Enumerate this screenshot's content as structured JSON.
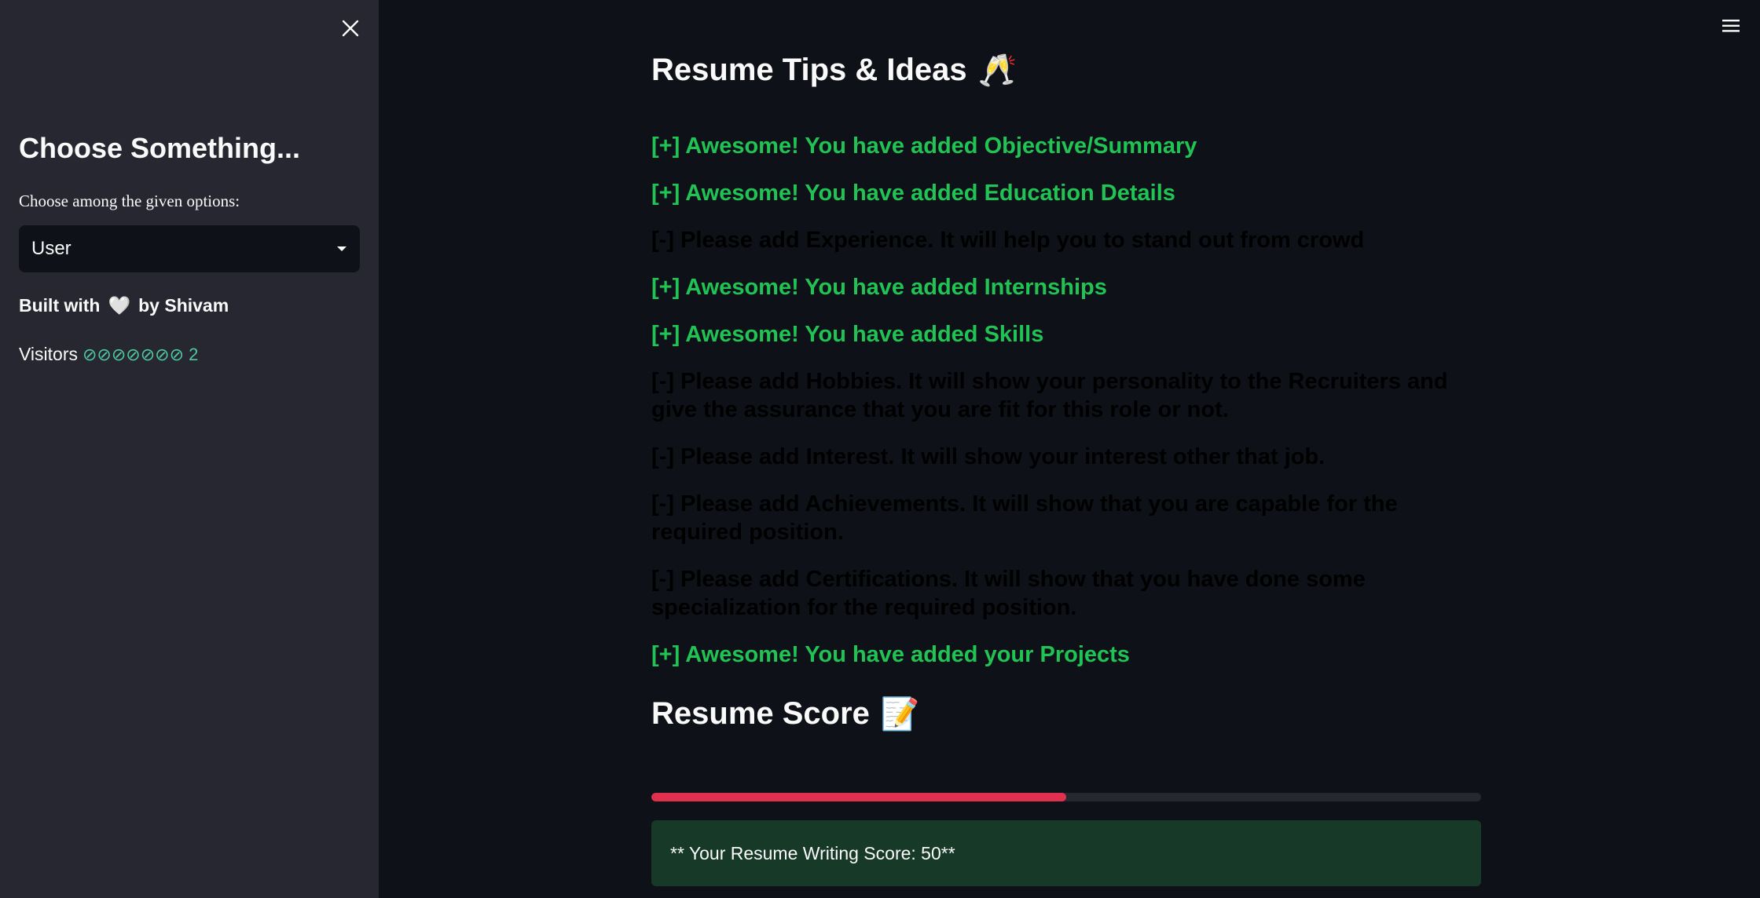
{
  "sidebar": {
    "title": "Choose Something...",
    "select_label": "Choose among the given options:",
    "select_value": "User",
    "built_with": "Built with",
    "built_by": "by Shivam",
    "heart_emoji": "🤍",
    "visitors_label": "Visitors",
    "visitors_count": "⊘⊘⊘⊘⊘⊘⊘ 2"
  },
  "main": {
    "tips_title": "Resume Tips & Ideas",
    "tips_emoji": "🥂",
    "tips": [
      {
        "text": "[+] Awesome! You have added Objective/Summary",
        "status": "good"
      },
      {
        "text": "[+] Awesome! You have added Education Details",
        "status": "good"
      },
      {
        "text": "[-] Please add Experience. It will help you to stand out from crowd",
        "status": "bad"
      },
      {
        "text": "[+] Awesome! You have added Internships",
        "status": "good"
      },
      {
        "text": "[+] Awesome! You have added Skills",
        "status": "good"
      },
      {
        "text": "[-] Please add Hobbies. It will show your personality to the Recruiters and give the assurance that you are fit for this role or not.",
        "status": "bad"
      },
      {
        "text": "[-] Please add Interest. It will show your interest other that job.",
        "status": "bad"
      },
      {
        "text": "[-] Please add Achievements. It will show that you are capable for the required position.",
        "status": "bad"
      },
      {
        "text": "[-] Please add Certifications. It will show that you have done some specialization for the required position.",
        "status": "bad"
      },
      {
        "text": "[+] Awesome! You have added your Projects",
        "status": "good"
      }
    ],
    "score_title": "Resume Score",
    "score_emoji": "📝",
    "score_progress": 0.5,
    "score_text": "** Your Resume Writing Score: 50**"
  },
  "colors": {
    "background": "#0e1117",
    "sidebar": "#262730",
    "good": "#21c354",
    "bad": "#000000",
    "progress": "#e0304e",
    "success_box": "#173928"
  }
}
